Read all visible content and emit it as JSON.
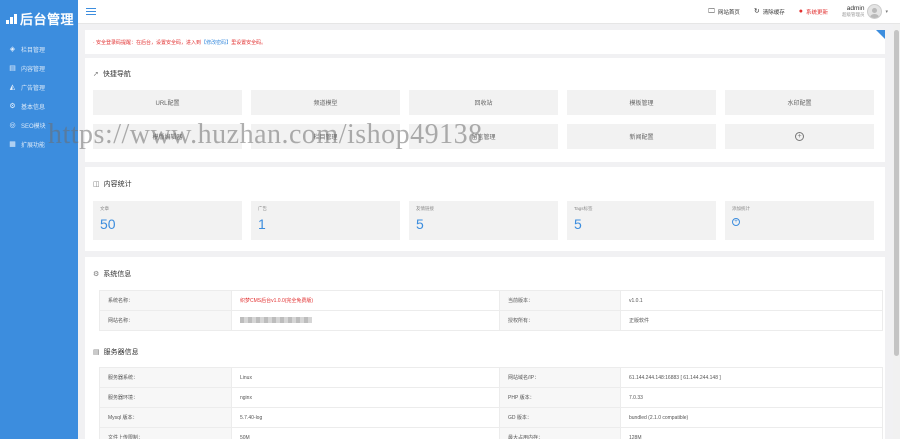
{
  "app": {
    "logo_text": "后台管理"
  },
  "sidebar": {
    "items": [
      {
        "label": "栏目管理",
        "icon": "layers-icon"
      },
      {
        "label": "内容管理",
        "icon": "document-icon"
      },
      {
        "label": "广告管理",
        "icon": "megaphone-icon"
      },
      {
        "label": "基本信息",
        "icon": "gear-icon"
      },
      {
        "label": "SEO模块",
        "icon": "seo-icon"
      },
      {
        "label": "扩展功能",
        "icon": "grid-icon"
      }
    ]
  },
  "header": {
    "links": [
      {
        "label": "网站首页",
        "icon": "monitor-icon"
      },
      {
        "label": "清除缓存",
        "icon": "refresh-icon"
      },
      {
        "label": "系统更新",
        "icon": "alert-icon"
      }
    ],
    "user": {
      "name": "admin",
      "role": "超级管理员"
    }
  },
  "notice": {
    "prefix": "· 安全登录码提醒：在后台，设置安全码，进入到",
    "highlight": "【修改密码】",
    "suffix": "里设置安全码。"
  },
  "quick_nav": {
    "title": "快捷导航",
    "buttons": [
      "URL配置",
      "频道模型",
      "回收站",
      "模板管理",
      "水印配置",
      "模版编辑器",
      "栏目管理",
      "留言管理",
      "新闻配置"
    ]
  },
  "stats": {
    "title": "内容统计",
    "cards": [
      {
        "label": "文章",
        "value": "50"
      },
      {
        "label": "广告",
        "value": "1"
      },
      {
        "label": "友情链接",
        "value": "5"
      },
      {
        "label": "Tags标签",
        "value": "5"
      }
    ],
    "add_label": "添加统计"
  },
  "system": {
    "title": "系统信息",
    "rows": [
      {
        "k1": "系统名称：",
        "v1": "织梦CMS后台v1.0.0(完全免费版)",
        "k2": "当前版本：",
        "v2": "v1.0.1"
      },
      {
        "k1": "网站名称：",
        "v1": "",
        "k2": "授权所有：",
        "v2": "正版软件"
      }
    ]
  },
  "server": {
    "title": "服务器信息",
    "rows": [
      {
        "k1": "服务器系统：",
        "v1": "Linux",
        "k2": "网站域名/IP：",
        "v2": "61.144.244.148:16883 [ 61.144.244.148 ]"
      },
      {
        "k1": "服务器环境：",
        "v1": "nginx",
        "k2": "PHP 版本：",
        "v2": "7.0.33"
      },
      {
        "k1": "Mysql 版本：",
        "v1": "5.7.40-log",
        "k2": "GD 版本：",
        "v2": "bundled (2.1.0 compatible)"
      },
      {
        "k1": "文件上传限制：",
        "v1": "50M",
        "k2": "最大占用内存：",
        "v2": "128M"
      }
    ]
  },
  "watermark": "https://www.huzhan.com/ishop49138",
  "colors": {
    "accent": "#3c8dde",
    "danger": "#e23030"
  }
}
